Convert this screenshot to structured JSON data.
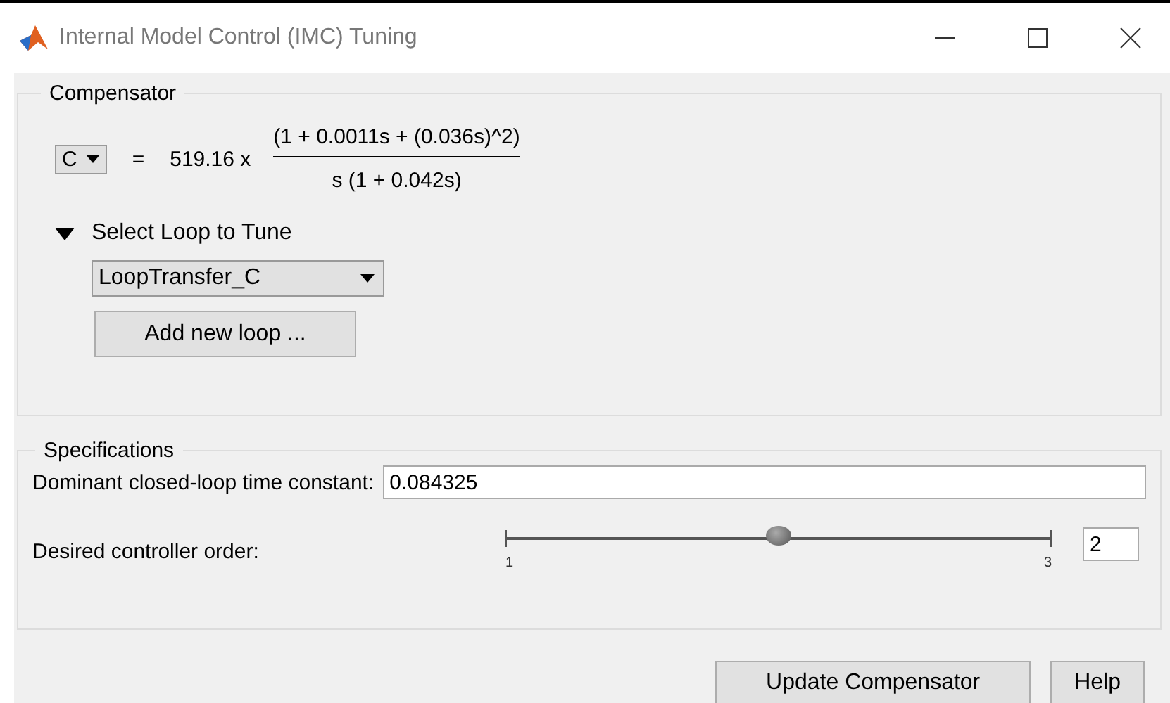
{
  "window": {
    "title": "Internal Model Control (IMC) Tuning"
  },
  "compensator": {
    "title": "Compensator",
    "selector": "C",
    "equals": "=",
    "gain": "519.16 x",
    "numerator": "(1 + 0.0011s + (0.036s)^2)",
    "denominator": "s (1 + 0.042s)",
    "loop_section": {
      "label": "Select Loop to Tune",
      "expanded": true,
      "loop": "LoopTransfer_C",
      "add_button": "Add new loop ..."
    }
  },
  "specifications": {
    "title": "Specifications",
    "time_constant_label": "Dominant closed-loop time constant:",
    "time_constant": "0.084325",
    "order_label": "Desired controller order:",
    "order_slider": {
      "level": 0.5,
      "min_label": "1",
      "max_label": "3"
    },
    "order_value": "2"
  },
  "buttons": [
    "Update Compensator",
    "Help"
  ]
}
